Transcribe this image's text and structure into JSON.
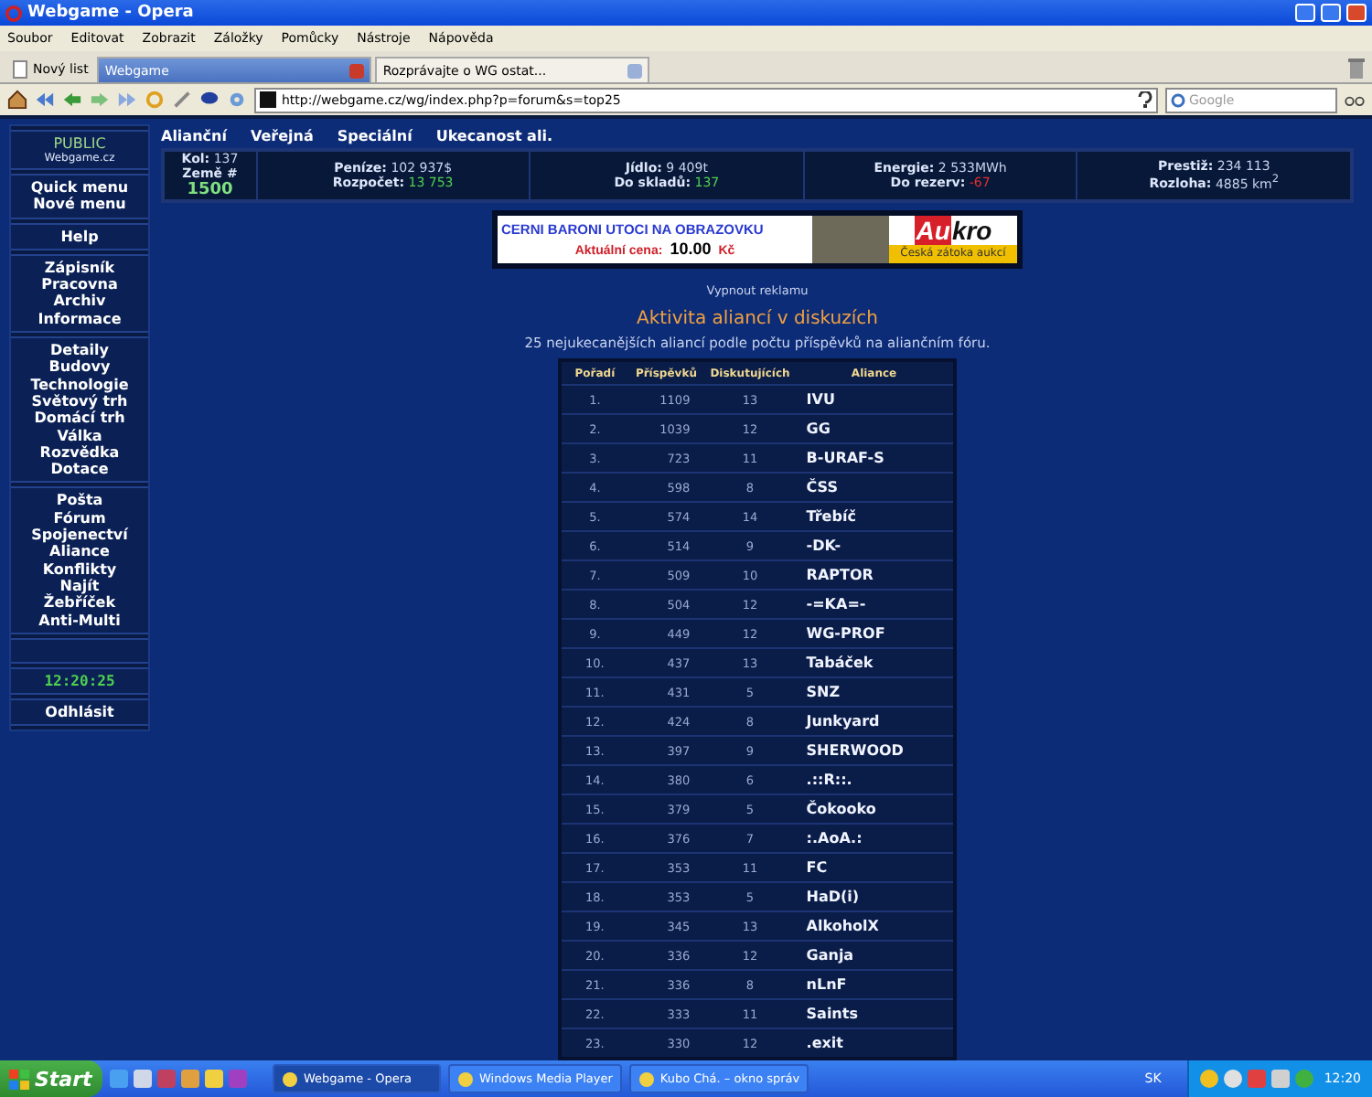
{
  "window": {
    "title": "Webgame - Opera"
  },
  "menu": [
    "Soubor",
    "Editovat",
    "Zobrazit",
    "Záložky",
    "Pomůcky",
    "Nástroje",
    "Nápověda"
  ],
  "new_tab": "Nový list",
  "tabs": [
    {
      "label": "Webgame",
      "selected": true
    },
    {
      "label": "Rozprávajte o WG ostat...",
      "selected": false
    }
  ],
  "address": {
    "url": "http://webgame.cz/wg/index.php?p=forum&s=top25"
  },
  "search": {
    "placeholder": "Google"
  },
  "sidebar": {
    "brand": "PUBLIC",
    "site": "Webgame.cz",
    "groups": [
      [
        "Quick menu",
        "Nové menu"
      ],
      [
        "Help"
      ],
      [
        "Zápisník",
        "Pracovna",
        "Archiv",
        "Informace"
      ],
      [
        "Detaily",
        "Budovy",
        "Technologie",
        "Světový trh",
        "Domácí trh",
        "Válka",
        "Rozvědka",
        "Dotace"
      ],
      [
        "Pošta",
        "Fórum",
        "Spojenectví",
        "Aliance",
        "Konflikty",
        "Najít",
        "Žebříček",
        "Anti-Multi"
      ]
    ],
    "clock": "12:20:25",
    "logout": "Odhlásit"
  },
  "nav": [
    "Alianční",
    "Veřejná",
    "Speciální",
    "Ukecanost ali."
  ],
  "stats": [
    {
      "lines": [
        {
          "label": "Kol:",
          "value": "137",
          "color": "#c8d4ee"
        },
        {
          "label": "Země #"
        },
        {
          "value": "1500",
          "color": "#7fe07f"
        }
      ]
    },
    {
      "lines": [
        {
          "label": "Peníze:",
          "value": "102 937$",
          "color": "#c8d4ee"
        },
        {
          "label": "Rozpočet:",
          "value": "13 753",
          "color": "#4fd04f"
        }
      ]
    },
    {
      "lines": [
        {
          "label": "Jídlo:",
          "value": "9 409t",
          "color": "#c8d4ee"
        },
        {
          "label": "Do skladů:",
          "value": "137",
          "color": "#4fd04f"
        }
      ]
    },
    {
      "lines": [
        {
          "label": "Energie:",
          "value": "2 533MWh",
          "color": "#c8d4ee"
        },
        {
          "label": "Do rezerv:",
          "value": "-67",
          "color": "#e03030"
        }
      ]
    },
    {
      "lines": [
        {
          "label": "Prestiž:",
          "value": "234 113",
          "color": "#c8d4ee"
        },
        {
          "label": "Rozloha:",
          "value": "4885 km$^{2}$",
          "color": "#c8d4ee"
        }
      ]
    }
  ],
  "ad": {
    "headline": "CERNI BARONI UTOCI NA OBRAZOVKU",
    "price_label": "Aktuální cena:",
    "price": "10.00",
    "currency": "Kč",
    "logo_a": "Au",
    "logo_b": "kro",
    "slogan": "Česká zátoka aukcí"
  },
  "ad_off": "Vypnout reklamu",
  "heading": "Aktivita aliancí v diskuzích",
  "subtitle": "25 nejukecanějších aliancí podle počtu příspěvků na aliančním fóru.",
  "table": {
    "columns": [
      "Pořadí",
      "Příspěvků",
      "Diskutujících",
      "Aliance"
    ],
    "rows": [
      [
        "1.",
        "1109",
        "13",
        "IVU"
      ],
      [
        "2.",
        "1039",
        "12",
        "GG"
      ],
      [
        "3.",
        "723",
        "11",
        "B-URAF-S"
      ],
      [
        "4.",
        "598",
        "8",
        "ČSS"
      ],
      [
        "5.",
        "574",
        "14",
        "Třebíč"
      ],
      [
        "6.",
        "514",
        "9",
        "-DK-"
      ],
      [
        "7.",
        "509",
        "10",
        "RAPTOR"
      ],
      [
        "8.",
        "504",
        "12",
        "-=KA=-"
      ],
      [
        "9.",
        "449",
        "12",
        "WG-PROF"
      ],
      [
        "10.",
        "437",
        "13",
        "Tabáček"
      ],
      [
        "11.",
        "431",
        "5",
        "SNZ"
      ],
      [
        "12.",
        "424",
        "8",
        "Junkyard"
      ],
      [
        "13.",
        "397",
        "9",
        "SHERWOOD"
      ],
      [
        "14.",
        "380",
        "6",
        ".::R::."
      ],
      [
        "15.",
        "379",
        "5",
        "Čokooko"
      ],
      [
        "16.",
        "376",
        "7",
        ":.AoA.:"
      ],
      [
        "17.",
        "353",
        "11",
        "FC"
      ],
      [
        "18.",
        "353",
        "5",
        "HaD(i)"
      ],
      [
        "19.",
        "345",
        "13",
        "AlkoholX"
      ],
      [
        "20.",
        "336",
        "12",
        "Ganja"
      ],
      [
        "21.",
        "336",
        "8",
        "nLnF"
      ],
      [
        "22.",
        "333",
        "11",
        "Saints"
      ],
      [
        "23.",
        "330",
        "12",
        ".exit"
      ]
    ]
  },
  "taskbar": {
    "start": "Start",
    "buttons": [
      {
        "label": "Webgame - Opera",
        "selected": true
      },
      {
        "label": "Windows Media Player",
        "selected": false
      },
      {
        "label": "Kubo Chá. – okno správ",
        "selected": false
      }
    ],
    "language": "SK",
    "clock": "12:20"
  }
}
